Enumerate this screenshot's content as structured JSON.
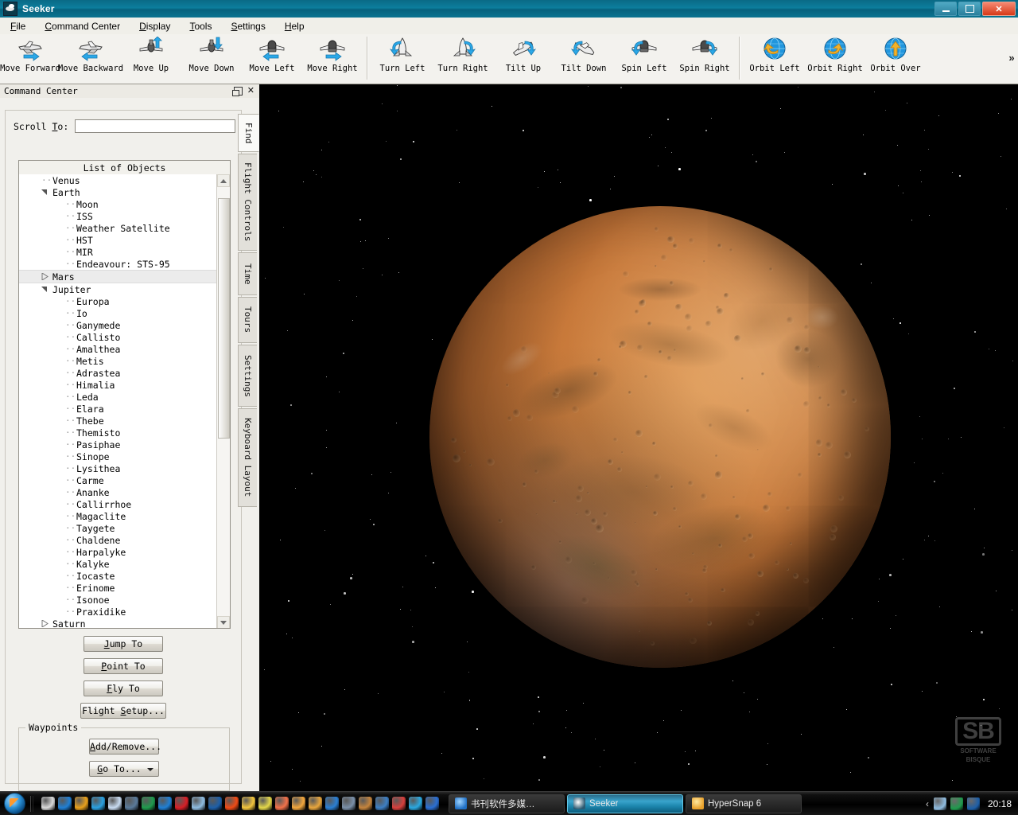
{
  "window": {
    "title": "Seeker",
    "icon": "seeker-app-icon",
    "buttons": {
      "minimize": "–",
      "maximize": "❐",
      "close": "✕"
    }
  },
  "menubar": {
    "items": [
      {
        "label": "File",
        "accel": "F"
      },
      {
        "label": "Command Center",
        "accel": "C"
      },
      {
        "label": "Display",
        "accel": "D"
      },
      {
        "label": "Tools",
        "accel": "T"
      },
      {
        "label": "Settings",
        "accel": "S"
      },
      {
        "label": "Help",
        "accel": "H"
      }
    ]
  },
  "toolbar": {
    "overflow": "»",
    "groups": [
      {
        "name": "move",
        "buttons": [
          {
            "label": "Move Forward",
            "icon": "shuttle-right-arrow-icon"
          },
          {
            "label": "Move Backward",
            "icon": "shuttle-left-arrow-icon"
          },
          {
            "label": "Move Up",
            "icon": "shuttle-up-arrow-icon"
          },
          {
            "label": "Move Down",
            "icon": "shuttle-down-arrow-icon"
          },
          {
            "label": "Move Left",
            "icon": "shuttle-front-left-arrow-icon"
          },
          {
            "label": "Move Right",
            "icon": "shuttle-front-right-arrow-icon"
          }
        ]
      },
      {
        "name": "rotate",
        "buttons": [
          {
            "label": "Turn Left",
            "icon": "shuttle-turn-left-icon"
          },
          {
            "label": "Turn Right",
            "icon": "shuttle-turn-right-icon"
          },
          {
            "label": "Tilt Up",
            "icon": "shuttle-tilt-up-icon"
          },
          {
            "label": "Tilt Down",
            "icon": "shuttle-tilt-down-icon"
          },
          {
            "label": "Spin Left",
            "icon": "shuttle-spin-left-icon"
          },
          {
            "label": "Spin Right",
            "icon": "shuttle-spin-right-icon"
          }
        ]
      },
      {
        "name": "orbit",
        "buttons": [
          {
            "label": "Orbit Left",
            "icon": "globe-orbit-left-icon"
          },
          {
            "label": "Orbit Right",
            "icon": "globe-orbit-right-icon"
          },
          {
            "label": "Orbit Over",
            "icon": "globe-orbit-over-icon"
          }
        ]
      }
    ]
  },
  "command_center": {
    "title": "Command Center",
    "float_button": "❐",
    "close_button": "✕",
    "scroll_to": {
      "label": "Scroll To:",
      "accel": "T",
      "value": "",
      "placeholder": ""
    },
    "tree_header": "List of Objects",
    "selected_object": "Mars",
    "tree": [
      {
        "label": "Venus",
        "depth": 1,
        "state": "leaf"
      },
      {
        "label": "Earth",
        "depth": 1,
        "state": "expanded"
      },
      {
        "label": "Moon",
        "depth": 2,
        "state": "leaf"
      },
      {
        "label": "ISS",
        "depth": 2,
        "state": "leaf"
      },
      {
        "label": "Weather Satellite",
        "depth": 2,
        "state": "leaf"
      },
      {
        "label": "HST",
        "depth": 2,
        "state": "leaf"
      },
      {
        "label": "MIR",
        "depth": 2,
        "state": "leaf"
      },
      {
        "label": "Endeavour: STS-95",
        "depth": 2,
        "state": "leaf"
      },
      {
        "label": "Mars",
        "depth": 1,
        "state": "collapsed",
        "selected": true
      },
      {
        "label": "Jupiter",
        "depth": 1,
        "state": "expanded"
      },
      {
        "label": "Europa",
        "depth": 2,
        "state": "leaf"
      },
      {
        "label": "Io",
        "depth": 2,
        "state": "leaf"
      },
      {
        "label": "Ganymede",
        "depth": 2,
        "state": "leaf"
      },
      {
        "label": "Callisto",
        "depth": 2,
        "state": "leaf"
      },
      {
        "label": "Amalthea",
        "depth": 2,
        "state": "leaf"
      },
      {
        "label": "Metis",
        "depth": 2,
        "state": "leaf"
      },
      {
        "label": "Adrastea",
        "depth": 2,
        "state": "leaf"
      },
      {
        "label": "Himalia",
        "depth": 2,
        "state": "leaf"
      },
      {
        "label": "Leda",
        "depth": 2,
        "state": "leaf"
      },
      {
        "label": "Elara",
        "depth": 2,
        "state": "leaf"
      },
      {
        "label": "Thebe",
        "depth": 2,
        "state": "leaf"
      },
      {
        "label": "Themisto",
        "depth": 2,
        "state": "leaf"
      },
      {
        "label": "Pasiphae",
        "depth": 2,
        "state": "leaf"
      },
      {
        "label": "Sinope",
        "depth": 2,
        "state": "leaf"
      },
      {
        "label": "Lysithea",
        "depth": 2,
        "state": "leaf"
      },
      {
        "label": "Carme",
        "depth": 2,
        "state": "leaf"
      },
      {
        "label": "Ananke",
        "depth": 2,
        "state": "leaf"
      },
      {
        "label": "Callirrhoe",
        "depth": 2,
        "state": "leaf"
      },
      {
        "label": "Magaclite",
        "depth": 2,
        "state": "leaf"
      },
      {
        "label": "Taygete",
        "depth": 2,
        "state": "leaf"
      },
      {
        "label": "Chaldene",
        "depth": 2,
        "state": "leaf"
      },
      {
        "label": "Harpalyke",
        "depth": 2,
        "state": "leaf"
      },
      {
        "label": "Kalyke",
        "depth": 2,
        "state": "leaf"
      },
      {
        "label": "Iocaste",
        "depth": 2,
        "state": "leaf"
      },
      {
        "label": "Erinome",
        "depth": 2,
        "state": "leaf"
      },
      {
        "label": "Isonoe",
        "depth": 2,
        "state": "leaf"
      },
      {
        "label": "Praxidike",
        "depth": 2,
        "state": "leaf"
      },
      {
        "label": "Saturn",
        "depth": 1,
        "state": "collapsed"
      }
    ],
    "vertical_tabs": [
      {
        "label": "Find",
        "active": true
      },
      {
        "label": "Flight Controls",
        "active": false
      },
      {
        "label": "Time",
        "active": false
      },
      {
        "label": "Tours",
        "active": false
      },
      {
        "label": "Settings",
        "active": false
      },
      {
        "label": "Keyboard Layout",
        "active": false
      }
    ],
    "actions": [
      {
        "label": "Jump To",
        "accel": "J"
      },
      {
        "label": "Point To",
        "accel": "P"
      },
      {
        "label": "Fly To",
        "accel": "F"
      },
      {
        "label": "Flight Setup...",
        "accel": "S"
      }
    ],
    "waypoints": {
      "legend": "Waypoints",
      "add_remove": "Add/Remove...",
      "go_to": "Go To..."
    }
  },
  "viewport": {
    "object": "Mars",
    "watermark": {
      "mark": "SB",
      "line1": "SOFTWARE",
      "line2": "BISQUE"
    }
  },
  "taskbar": {
    "start": "start-orb-icon",
    "quick_launch": [
      {
        "icon": "calculator-icon",
        "color": "#d9d9d9"
      },
      {
        "icon": "internet-explorer-icon",
        "color": "#1f7fd4"
      },
      {
        "icon": "firefox-icon",
        "color": "#e8a01c"
      },
      {
        "icon": "media-player-icon",
        "color": "#2aa0e0"
      },
      {
        "icon": "notepad-icon",
        "color": "#c9dcf2"
      },
      {
        "icon": "archive-icon",
        "color": "#5a7a9a"
      },
      {
        "icon": "umbrella-icon",
        "color": "#1f9b4d"
      },
      {
        "icon": "globe-app-icon",
        "color": "#1f7fd4"
      },
      {
        "icon": "acrobat-icon",
        "color": "#d61f26"
      },
      {
        "icon": "paint-icon",
        "color": "#8fbce0"
      },
      {
        "icon": "shield-blue-icon",
        "color": "#1d5fa8"
      },
      {
        "icon": "download-icon",
        "color": "#f04b16"
      },
      {
        "icon": "camera-app-icon",
        "color": "#f2c53d"
      },
      {
        "icon": "character-icon",
        "color": "#e4d84a"
      },
      {
        "icon": "spiral-icon",
        "color": "#f2714a"
      },
      {
        "icon": "qq-penguin-icon",
        "color": "#f2a63d"
      },
      {
        "icon": "folder-icon",
        "color": "#e8a63d"
      },
      {
        "icon": "network-icon",
        "color": "#2a7fd4"
      },
      {
        "icon": "tool-icon",
        "color": "#7a8fa8"
      },
      {
        "icon": "browser-alt-icon",
        "color": "#c4843d"
      },
      {
        "icon": "window-app-icon",
        "color": "#3d7fc4"
      },
      {
        "icon": "flame-icon",
        "color": "#d6403d"
      },
      {
        "icon": "kugou-k-icon",
        "color": "#2aa8e0"
      },
      {
        "icon": "compass-icon",
        "color": "#2a6fd4"
      }
    ],
    "windows": [
      {
        "label": "书刊软件多媒…",
        "icon": "maxthon-icon",
        "active": false
      },
      {
        "label": "Seeker",
        "icon": "seeker-app-icon",
        "active": true
      },
      {
        "label": "HyperSnap 6",
        "icon": "hypersnap-icon",
        "active": false
      }
    ],
    "tray": {
      "chevron": "‹",
      "icons": [
        {
          "icon": "paint-tray-icon",
          "color": "#8fbce0"
        },
        {
          "icon": "umbrella-tray-icon",
          "color": "#1f9b4d"
        },
        {
          "icon": "shield-tray-icon",
          "color": "#1d5fa8"
        }
      ],
      "clock": "20:18"
    }
  }
}
